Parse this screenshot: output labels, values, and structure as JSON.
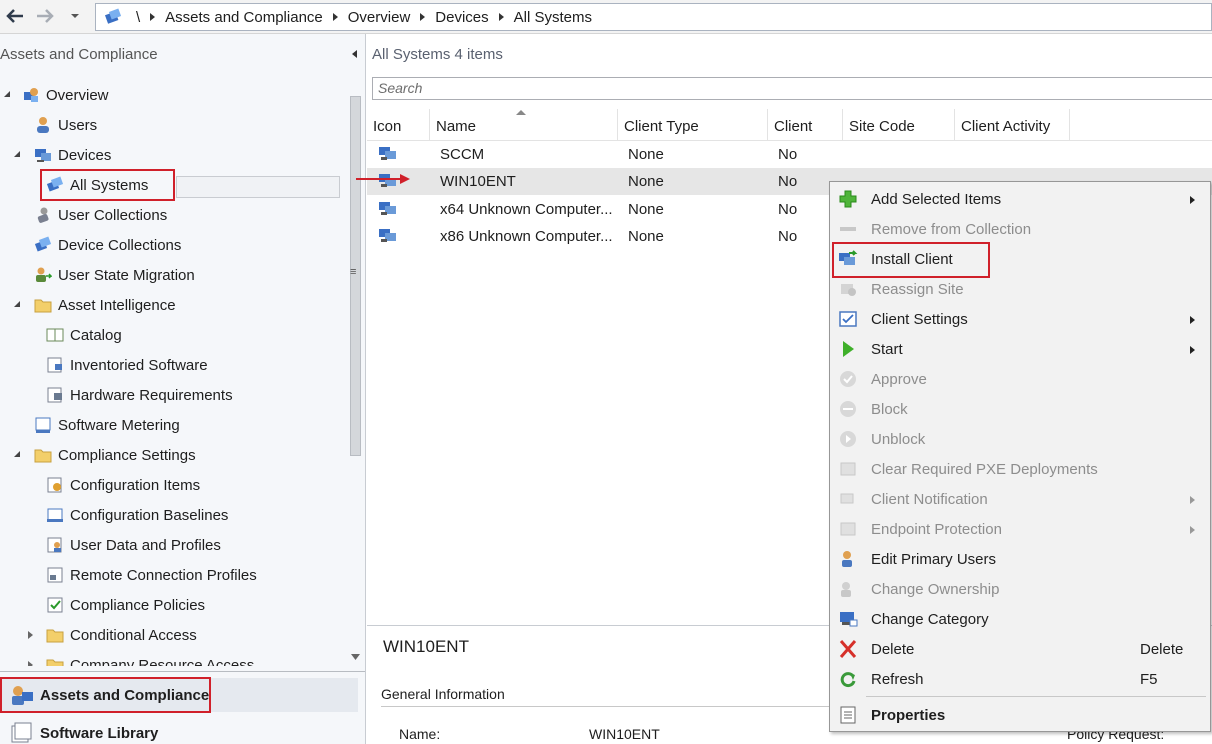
{
  "breadcrumb": {
    "root": "\\",
    "items": [
      "Assets and Compliance",
      "Overview",
      "Devices",
      "All Systems"
    ]
  },
  "nav": {
    "pane_title": "Assets and Compliance",
    "tree": {
      "overview": "Overview",
      "users": "Users",
      "devices": "Devices",
      "all_systems": "All Systems",
      "user_collections": "User Collections",
      "device_collections": "Device Collections",
      "user_state_migration": "User State Migration",
      "asset_intelligence": "Asset Intelligence",
      "catalog": "Catalog",
      "inventoried_software": "Inventoried Software",
      "hardware_requirements": "Hardware Requirements",
      "software_metering": "Software Metering",
      "compliance_settings": "Compliance Settings",
      "configuration_items": "Configuration Items",
      "configuration_baselines": "Configuration Baselines",
      "user_data_profiles": "User Data and Profiles",
      "remote_connection_profiles": "Remote Connection Profiles",
      "compliance_policies": "Compliance Policies",
      "conditional_access": "Conditional Access",
      "company_resource_access": "Company Resource Access"
    },
    "workspaces": {
      "assets": "Assets and Compliance",
      "software_library": "Software Library"
    }
  },
  "list": {
    "title": "All Systems 4 items",
    "search_placeholder": "Search",
    "columns": {
      "icon": "Icon",
      "name": "Name",
      "client_type": "Client Type",
      "client": "Client",
      "site_code": "Site Code",
      "client_activity": "Client Activity"
    },
    "rows": [
      {
        "name": "SCCM",
        "client_type": "None",
        "client": "No"
      },
      {
        "name": "WIN10ENT",
        "client_type": "None",
        "client": "No"
      },
      {
        "name": "x64 Unknown Computer...",
        "client_type": "None",
        "client": "No"
      },
      {
        "name": "x86 Unknown Computer...",
        "client_type": "None",
        "client": "No"
      }
    ]
  },
  "details": {
    "title": "WIN10ENT",
    "section": "General Information",
    "name_label": "Name:",
    "name_value": "WIN10ENT",
    "policy_label": "Policy Request:"
  },
  "context_menu": {
    "add_selected_items": "Add Selected Items",
    "remove_from_collection": "Remove from Collection",
    "install_client": "Install Client",
    "reassign_site": "Reassign Site",
    "client_settings": "Client Settings",
    "start": "Start",
    "approve": "Approve",
    "block": "Block",
    "unblock": "Unblock",
    "clear_pxe": "Clear Required PXE Deployments",
    "client_notification": "Client Notification",
    "endpoint_protection": "Endpoint Protection",
    "edit_primary_users": "Edit Primary Users",
    "change_ownership": "Change Ownership",
    "change_category": "Change Category",
    "delete": "Delete",
    "delete_shortcut": "Delete",
    "refresh": "Refresh",
    "refresh_shortcut": "F5",
    "properties": "Properties"
  },
  "colors": {
    "highlight": "#d0202a",
    "selected_row": "#e6e6e6",
    "menu_bg": "#f2f2f2",
    "disabled_text": "#8d8d8d"
  }
}
